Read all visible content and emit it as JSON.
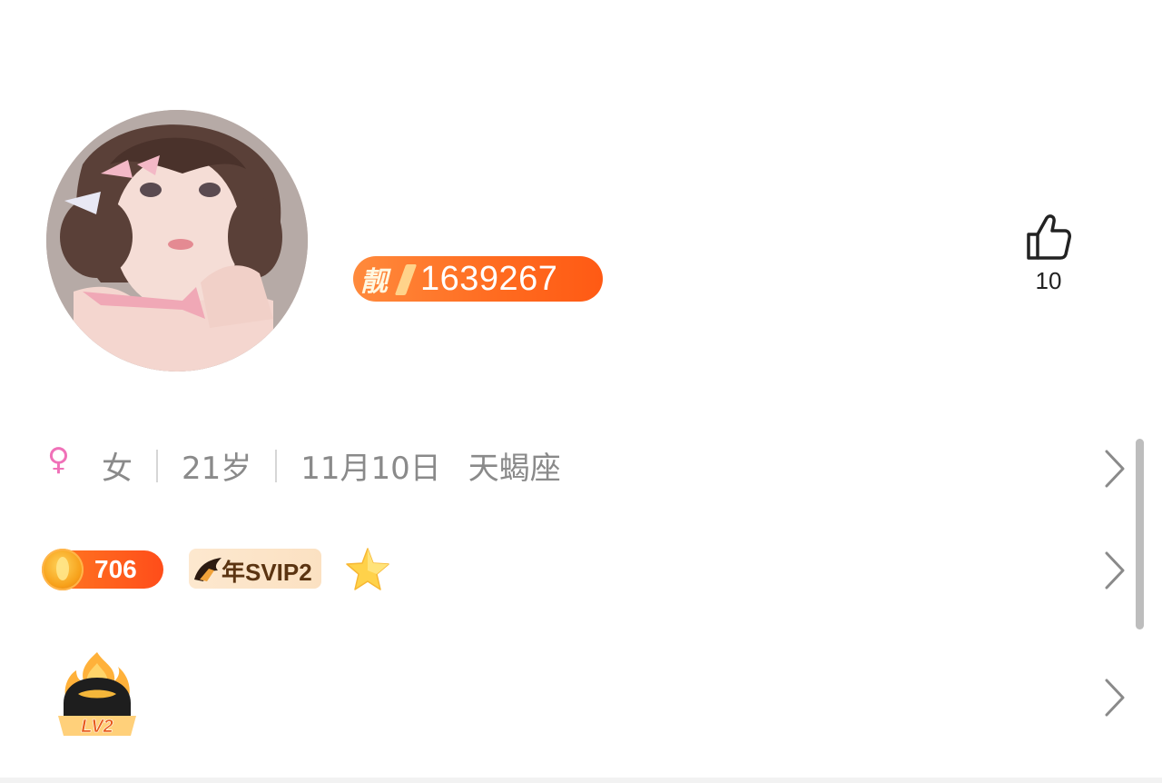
{
  "profile": {
    "pretty_id_mark": "靓",
    "pretty_id": "1639267",
    "like_count": "10"
  },
  "info": {
    "gender_symbol": "♀",
    "gender": "女",
    "age": "21岁",
    "birthday": "11月10日",
    "zodiac": "天蝎座"
  },
  "badges": {
    "coin_value": "706",
    "svip_label": "年SVIP2"
  },
  "level": {
    "label": "LV2"
  },
  "colors": {
    "accent_orange": "#ff6a1f",
    "gender_pink": "#f071b8",
    "text_gray": "#8a8a8a"
  },
  "icons": {
    "like": "thumbs-up-icon",
    "row_arrow": "chevron-right-icon",
    "gender": "female-icon",
    "coin": "coin-icon",
    "svip": "svip-wing-icon",
    "star": "star-icon",
    "level": "flame-level-icon"
  }
}
